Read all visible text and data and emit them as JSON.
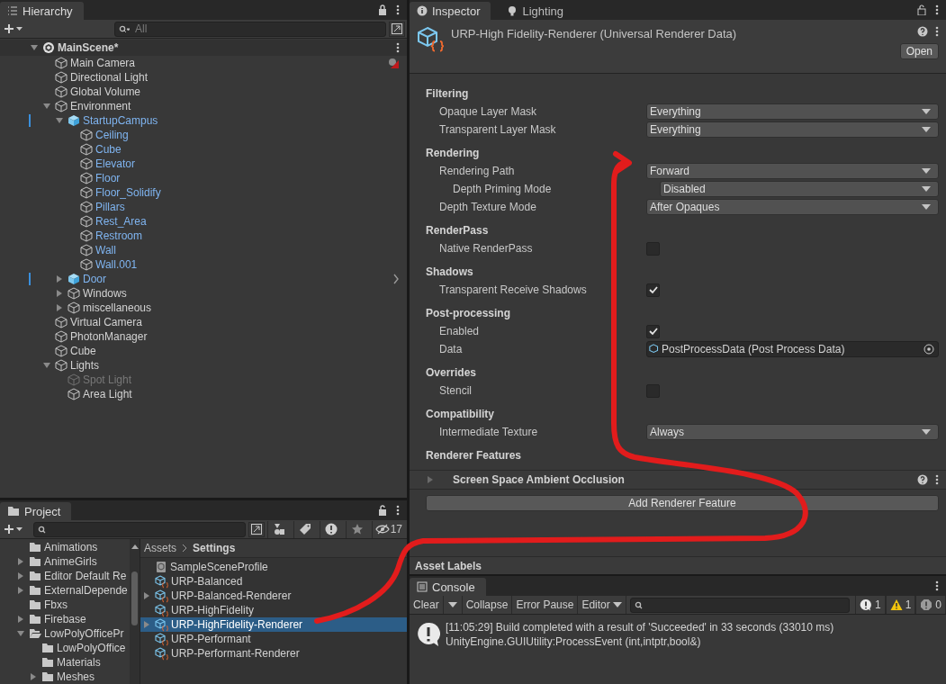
{
  "hierarchy": {
    "tab": "Hierarchy",
    "search": {
      "placeholder": "All"
    },
    "items": [
      {
        "name": "MainScene*",
        "kind": "scene",
        "expanded": true,
        "children": [
          {
            "name": "Main Camera",
            "kind": "object",
            "gizmo": true
          },
          {
            "name": "Directional Light",
            "kind": "object"
          },
          {
            "name": "Global Volume",
            "kind": "object"
          },
          {
            "name": "Environment",
            "kind": "object",
            "expanded": true,
            "children": [
              {
                "name": "StartupCampus",
                "kind": "prefab",
                "in_prefab": true,
                "modified": true,
                "expanded": true,
                "children": [
                  {
                    "name": "Ceiling",
                    "kind": "object",
                    "in_prefab": true
                  },
                  {
                    "name": "Cube",
                    "kind": "object",
                    "in_prefab": true
                  },
                  {
                    "name": "Elevator",
                    "kind": "object",
                    "in_prefab": true
                  },
                  {
                    "name": "Floor",
                    "kind": "object",
                    "in_prefab": true
                  },
                  {
                    "name": "Floor_Solidify",
                    "kind": "object",
                    "in_prefab": true
                  },
                  {
                    "name": "Pillars",
                    "kind": "object",
                    "in_prefab": true
                  },
                  {
                    "name": "Rest_Area",
                    "kind": "object",
                    "in_prefab": true
                  },
                  {
                    "name": "Restroom",
                    "kind": "object",
                    "in_prefab": true
                  },
                  {
                    "name": "Wall",
                    "kind": "object",
                    "in_prefab": true
                  },
                  {
                    "name": "Wall.001",
                    "kind": "object",
                    "in_prefab": true
                  }
                ]
              },
              {
                "name": "Door",
                "kind": "prefab",
                "in_prefab": true,
                "modified": true,
                "expanded": false,
                "chevron": true
              },
              {
                "name": "Windows",
                "kind": "object",
                "expanded": false
              },
              {
                "name": "miscellaneous",
                "kind": "object",
                "expanded": false
              }
            ]
          },
          {
            "name": "Virtual Camera",
            "kind": "object"
          },
          {
            "name": "PhotonManager",
            "kind": "object"
          },
          {
            "name": "Cube",
            "kind": "object"
          },
          {
            "name": "Lights",
            "kind": "object",
            "expanded": true,
            "children": [
              {
                "name": "Spot Light",
                "kind": "object",
                "disabled": true
              },
              {
                "name": "Area Light",
                "kind": "object"
              }
            ]
          }
        ]
      }
    ]
  },
  "project": {
    "tab": "Project",
    "hidden_count": "17",
    "folders": [
      {
        "name": "Animations"
      },
      {
        "name": "AnimeGirls",
        "expanded": false
      },
      {
        "name": "Editor Default Re",
        "expanded": false
      },
      {
        "name": "ExternalDepende",
        "expanded": false
      },
      {
        "name": "Fbxs"
      },
      {
        "name": "Firebase",
        "expanded": false
      },
      {
        "name": "LowPolyOfficePr",
        "expanded": true,
        "children": [
          {
            "name": "LowPolyOffice"
          },
          {
            "name": "Materials"
          },
          {
            "name": "Meshes",
            "expanded": false
          }
        ]
      }
    ],
    "breadcrumb": [
      "Assets",
      "Settings"
    ],
    "files": [
      {
        "name": "SampleSceneProfile",
        "kind": "volume",
        "selected": false
      },
      {
        "name": "URP-Balanced",
        "kind": "urp",
        "selected": false
      },
      {
        "name": "URP-Balanced-Renderer",
        "kind": "urp",
        "expanded": false,
        "selected": false
      },
      {
        "name": "URP-HighFidelity",
        "kind": "urp",
        "selected": false
      },
      {
        "name": "URP-HighFidelity-Renderer",
        "kind": "urp",
        "expanded": false,
        "selected": true
      },
      {
        "name": "URP-Performant",
        "kind": "urp",
        "selected": false
      },
      {
        "name": "URP-Performant-Renderer",
        "kind": "urp",
        "selected": false
      }
    ]
  },
  "inspector": {
    "tabs": [
      {
        "label": "Inspector",
        "kind": "info",
        "selected": true
      },
      {
        "label": "Lighting",
        "kind": "bulb",
        "selected": false
      }
    ],
    "title": "URP-High Fidelity-Renderer (Universal Renderer Data)",
    "open_button": "Open",
    "sections": [
      {
        "title": "Filtering",
        "rows": [
          {
            "label": "Opaque Layer Mask",
            "kind": "dropdown",
            "value": "Everything"
          },
          {
            "label": "Transparent Layer Mask",
            "kind": "dropdown",
            "value": "Everything"
          }
        ]
      },
      {
        "title": "Rendering",
        "rows": [
          {
            "label": "Rendering Path",
            "kind": "dropdown",
            "value": "Forward",
            "children": [
              {
                "label": "Depth Priming Mode",
                "kind": "dropdown",
                "value": "Disabled"
              }
            ]
          },
          {
            "label": "Depth Texture Mode",
            "kind": "dropdown",
            "value": "After Opaques"
          }
        ]
      },
      {
        "title": "RenderPass",
        "rows": [
          {
            "label": "Native RenderPass",
            "kind": "checkbox",
            "checked": false
          }
        ]
      },
      {
        "title": "Shadows",
        "rows": [
          {
            "label": "Transparent Receive Shadows",
            "kind": "checkbox",
            "checked": true
          }
        ]
      },
      {
        "title": "Post-processing",
        "rows": [
          {
            "label": "Enabled",
            "kind": "checkbox",
            "checked": true
          },
          {
            "label": "Data",
            "kind": "object",
            "value": "PostProcessData (Post Process Data)"
          }
        ]
      },
      {
        "title": "Overrides",
        "rows": [
          {
            "label": "Stencil",
            "kind": "checkbox",
            "checked": false
          }
        ]
      },
      {
        "title": "Compatibility",
        "rows": [
          {
            "label": "Intermediate Texture",
            "kind": "dropdown",
            "value": "Always"
          }
        ]
      }
    ],
    "features_title": "Renderer Features",
    "features": [
      {
        "name": "Screen Space Ambient Occlusion",
        "expanded": false
      }
    ],
    "add_button": "Add Renderer Feature",
    "asset_labels": "Asset Labels"
  },
  "console": {
    "tab": "Console",
    "buttons": [
      {
        "label": "Clear",
        "kind": "split"
      },
      {
        "label": "Collapse",
        "kind": "toggle"
      },
      {
        "label": "Error Pause",
        "kind": "toggle"
      },
      {
        "label": "Editor",
        "kind": "dropdown"
      }
    ],
    "counts": [
      {
        "kind": "info",
        "count": "1"
      },
      {
        "kind": "warning",
        "count": "1"
      },
      {
        "kind": "error",
        "count": "0"
      }
    ],
    "messages": [
      {
        "kind": "info",
        "lines": [
          "[11:05:29] Build completed with a result of 'Succeeded' in 33 seconds (33010 ms)",
          "UnityEngine.GUIUtility:ProcessEvent (int,intptr,bool&)"
        ]
      }
    ]
  }
}
